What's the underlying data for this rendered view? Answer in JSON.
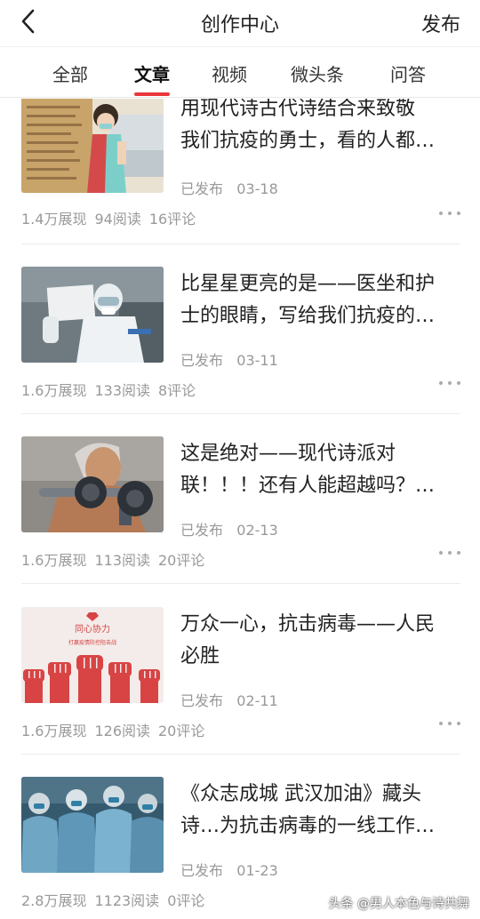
{
  "nav": {
    "title": "创作中心",
    "publish_label": "发布",
    "back_icon": "chevron-left-icon"
  },
  "tabs": [
    {
      "label": "全部"
    },
    {
      "label": "文章",
      "active": true
    },
    {
      "label": "视频"
    },
    {
      "label": "微头条"
    },
    {
      "label": "问答"
    }
  ],
  "articles": [
    {
      "title_line1": "用现代诗古代诗结合来致敬",
      "title_line2": "我们抗疫的勇士，看的人都…",
      "status": "已发布",
      "date": "03-18",
      "impressions": "1.4万展现",
      "reads": "94阅读",
      "comments": "16评论",
      "thumb": "nurse-illustration"
    },
    {
      "title_line1": "比星星更亮的是——医坐和护",
      "title_line2": "士的眼睛，写给我们抗疫的…",
      "status": "已发布",
      "date": "03-11",
      "impressions": "1.6万展现",
      "reads": "133阅读",
      "comments": "8评论",
      "thumb": "medic-in-protective-suit"
    },
    {
      "title_line1": "这是绝对——现代诗派对",
      "title_line2": "联！！！还有人能超越吗？…",
      "status": "已发布",
      "date": "02-13",
      "impressions": "1.6万展现",
      "reads": "113阅读",
      "comments": "20评论",
      "thumb": "man-with-dumbbell"
    },
    {
      "title_line1": "万众一心，抗击病毒——人民",
      "title_line2": "必胜",
      "status": "已发布",
      "date": "02-11",
      "impressions": "1.6万展现",
      "reads": "126阅读",
      "comments": "20评论",
      "thumb": "raised-fists-poster",
      "thumb_text1": "同心协力",
      "thumb_text2": "打赢疫情防控阻击战"
    },
    {
      "title_line1": "《众志成城 武汉加油》藏头",
      "title_line2": "诗…为抗击病毒的一线工作…",
      "status": "已发布",
      "date": "01-23",
      "impressions": "2.8万展现",
      "reads": "1123阅读",
      "comments": "0评论",
      "thumb": "medical-team"
    }
  ],
  "watermark": "头条 @男人本色与诗共舞",
  "colors": {
    "accent": "#e8363a",
    "muted": "#999999"
  }
}
